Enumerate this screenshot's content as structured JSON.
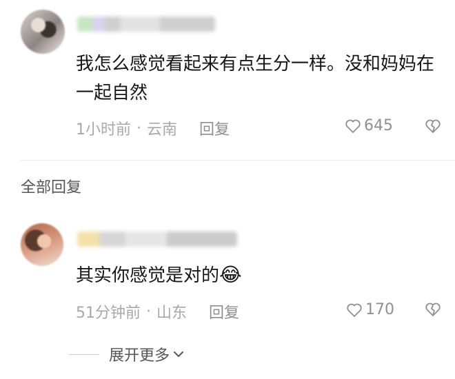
{
  "comment": {
    "text": "我怎么感觉看起来有点生分一样。没和妈妈在一起自然",
    "time": "1小时前",
    "separator": "·",
    "location": "云南",
    "reply_label": "回复",
    "likes": "645",
    "like_icon": "heart-outline-icon",
    "dislike_icon": "broken-heart-icon"
  },
  "replies_header": "全部回复",
  "reply": {
    "text": "其实你感觉是对的",
    "emoji": "😂",
    "time": "51分钟前",
    "separator": "·",
    "location": "山东",
    "reply_label": "回复",
    "likes": "170",
    "like_icon": "heart-outline-icon",
    "dislike_icon": "broken-heart-icon"
  },
  "expand_more": "展开更多",
  "colors": {
    "meta_text": "#a8a8a8",
    "primary_text": "#161616",
    "secondary_text": "#555555"
  }
}
